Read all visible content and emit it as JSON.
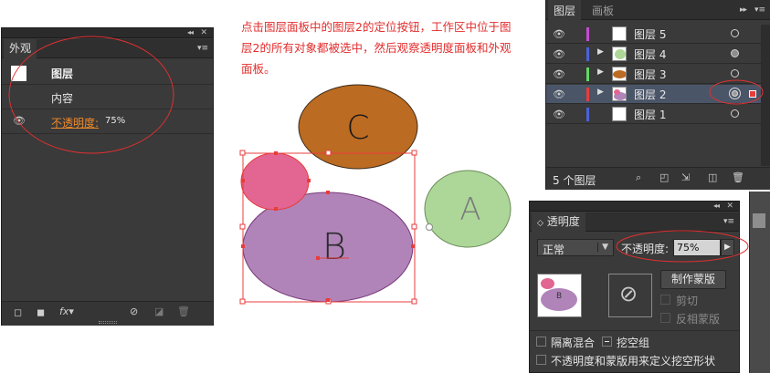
{
  "appearance_panel": {
    "tab": "外观",
    "rows": [
      {
        "label": "图层"
      },
      {
        "label": "内容"
      },
      {
        "label": "不透明度:",
        "value": "75%"
      }
    ]
  },
  "annotation": {
    "text": "点击图层面板中的图层2的定位按钮，工作区中位于图层2的所有对象都被选中，然后观察透明度面板和外观面板。"
  },
  "canvas": {
    "shape_c_label": "C",
    "shape_b_label": "B",
    "shape_a_label": "A",
    "colors": {
      "c": "#bb6b22",
      "b": "#b084b9",
      "pink": "#e26592",
      "a": "#acd798",
      "selection": "#e83c3c"
    }
  },
  "layers_panel": {
    "tabs": [
      "图层",
      "画板"
    ],
    "layers": [
      {
        "name": "图层 5",
        "color": "#c64bd1",
        "expand": false,
        "target": "empty"
      },
      {
        "name": "图层 4",
        "color": "#4c62d8",
        "expand": true,
        "target": "filled"
      },
      {
        "name": "图层 3",
        "color": "#63d863",
        "expand": true,
        "target": "empty"
      },
      {
        "name": "图层 2",
        "color": "#e83c3c",
        "expand": true,
        "target": "selected"
      },
      {
        "name": "图层 1",
        "color": "#4c62d8",
        "expand": false,
        "target": "empty"
      }
    ],
    "status": "5 个图层"
  },
  "transparency_panel": {
    "tab": "透明度",
    "blend_mode": "正常",
    "opacity_label": "不透明度:",
    "opacity_value": "75%",
    "make_mask_button": "制作蒙版",
    "clip_label": "剪切",
    "invert_mask_label": "反相蒙版",
    "isolate_blending_label": "隔离混合",
    "knockout_group_label": "挖空组",
    "opacity_mask_define_label": "不透明度和蒙版用来定义挖空形状"
  }
}
